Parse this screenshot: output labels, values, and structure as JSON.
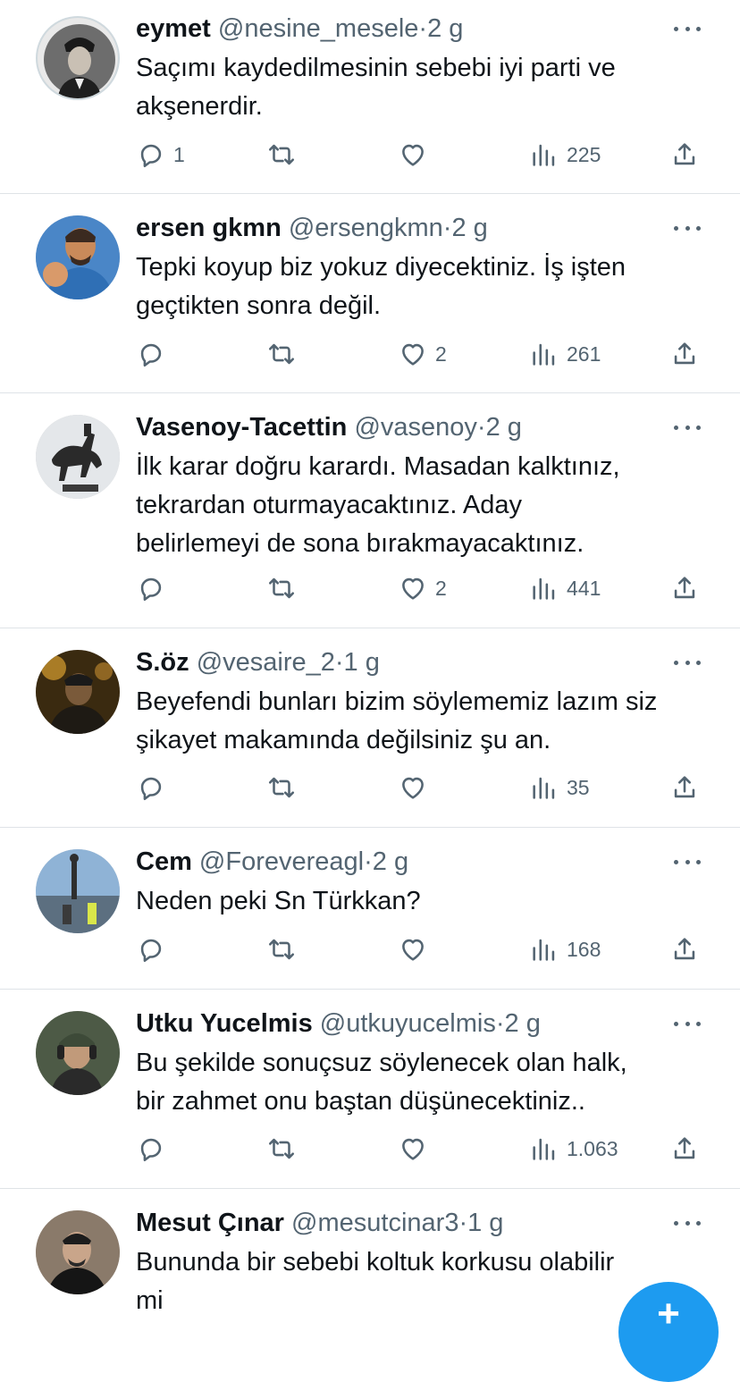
{
  "accent_color": "#1d9bf0",
  "tweets": [
    {
      "name": "eymet",
      "handle": "@nesine_mesele",
      "dot": "·",
      "time": "2 g",
      "text": "Saçımı kaydedilmesinin sebebi iyi parti ve\nakşenerdir.",
      "replies": "1",
      "retweets": "",
      "likes": "",
      "views": "225",
      "avatar_icon": "portrait-black-white-avatar"
    },
    {
      "name": "ersen gkmn",
      "handle": "@ersengkmn",
      "dot": "·",
      "time": "2 g",
      "text": "Tepki koyup biz yokuz diyecektiniz. İş işten\ngeçtikten sonra değil.",
      "replies": "",
      "retweets": "",
      "likes": "2",
      "views": "261",
      "avatar_icon": "cartoon-man-punch-avatar"
    },
    {
      "name": "Vasenoy-Tacettin",
      "handle": "@vasenoy",
      "dot": "·",
      "time": "2 g",
      "text": "İlk karar doğru karardı. Masadan kalktınız,\ntekrardan oturmayacaktınız. Aday\nbelirlemeyi de sona bırakmayacaktınız.",
      "replies": "",
      "retweets": "",
      "likes": "2",
      "views": "441",
      "avatar_icon": "horse-statue-avatar"
    },
    {
      "name": "S.öz",
      "handle": "@vesaire_2",
      "dot": "·",
      "time": "1 g",
      "text": "Beyefendi bunları bizim söylememiz lazım siz\nşikayet makamında değilsiniz şu an.",
      "replies": "",
      "retweets": "",
      "likes": "",
      "views": "35",
      "avatar_icon": "man-night-photo-avatar"
    },
    {
      "name": "Cem",
      "handle": "@Forevereagl",
      "dot": "·",
      "time": "2 g",
      "text": "Neden peki Sn Türkkan?",
      "replies": "",
      "retweets": "",
      "likes": "",
      "views": "168",
      "avatar_icon": "harbor-statue-avatar"
    },
    {
      "name": "Utku Yucelmis",
      "handle": "@utkuyucelmis",
      "dot": "·",
      "time": "2 g",
      "text": "Bu şekilde sonuçsuz söylenecek olan halk,\nbir zahmet onu baştan düşünecektiniz..",
      "replies": "",
      "retweets": "",
      "likes": "",
      "views": "1.063",
      "avatar_icon": "man-with-headset-avatar"
    },
    {
      "name": "Mesut Çınar",
      "handle": "@mesutcinar3",
      "dot": "·",
      "time": "1 g",
      "text": "Bununda bir sebebi koltuk korkusu olabilir\nmi",
      "replies": "",
      "retweets": "",
      "likes": "",
      "views": "",
      "avatar_icon": "man-portrait-avatar"
    }
  ],
  "compose_button": {
    "icon": "plus-icon",
    "label": "+"
  }
}
